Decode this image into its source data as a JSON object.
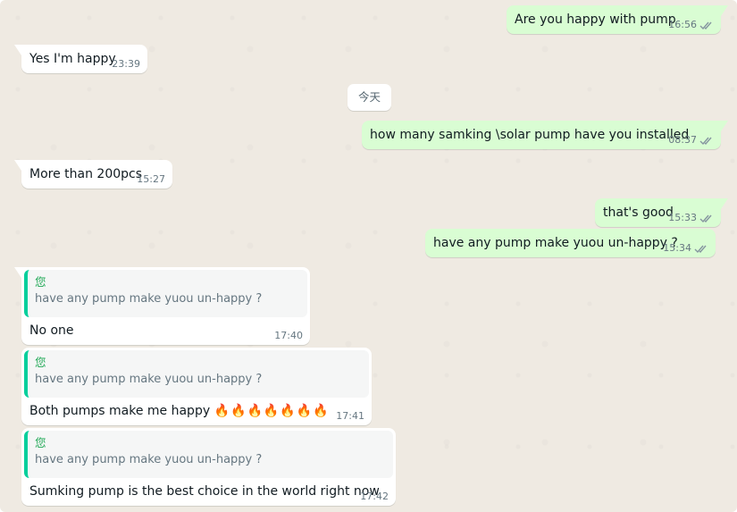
{
  "chat": {
    "date_divider": "今天",
    "messages": [
      {
        "text": "Are you happy with pump",
        "time": "16:56",
        "status": "read-ticks"
      },
      {
        "text": "Yes I'm happy",
        "time": "23:39"
      },
      {
        "text": "how many samking \\solar pump have you installed",
        "time": "08:37",
        "status": "read-ticks"
      },
      {
        "text": "More than 200pcs",
        "time": "15:27"
      },
      {
        "text": "that's good",
        "time": "15:33",
        "status": "read-ticks"
      },
      {
        "text": "have any pump make yuou un-happy ?",
        "time": "15:34",
        "status": "read-ticks"
      }
    ],
    "replies": [
      {
        "quote_author": "您",
        "quote_text": "have any pump make yuou un-happy ?",
        "text": "No one",
        "time": "17:40"
      },
      {
        "quote_author": "您",
        "quote_text": "have any pump make yuou un-happy ?",
        "text": "Both pumps make me happy",
        "emoji": "🔥🔥🔥🔥🔥🔥🔥",
        "time": "17:41"
      },
      {
        "quote_author": "您",
        "quote_text": "have any pump make yuou un-happy ?",
        "text": "Sumking pump is the best choice in the world right now",
        "time": "17:42"
      }
    ]
  },
  "colors": {
    "background": "#efeae2",
    "incoming": "#ffffff",
    "outgoing": "#d9fdd3",
    "quote_bar": "#06cf9c",
    "quote_author": "#1fa855",
    "meta_text": "#667781"
  }
}
